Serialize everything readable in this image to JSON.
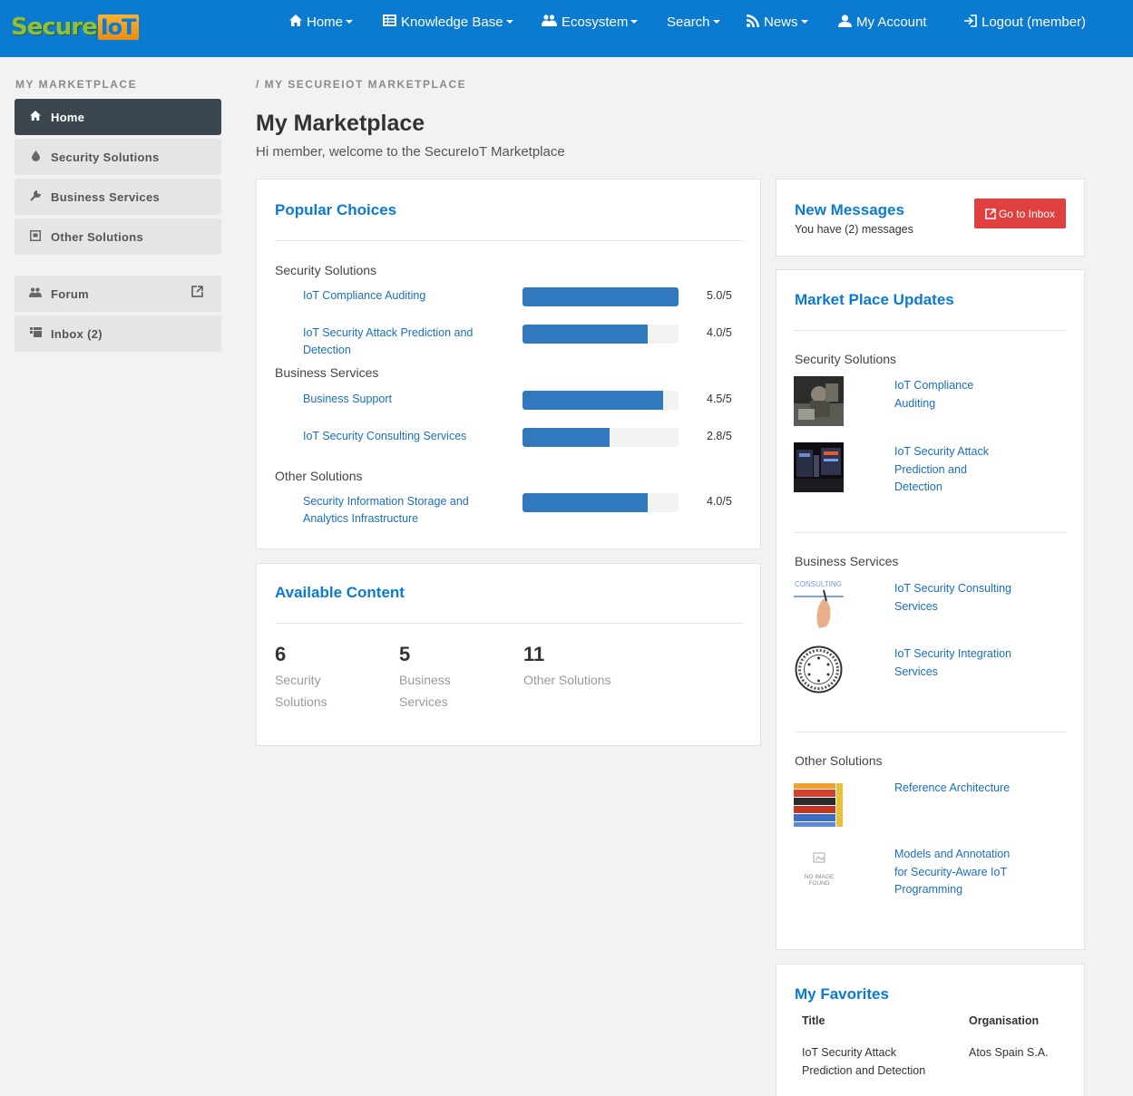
{
  "brand": {
    "part1": "Secure",
    "part2": "IoT"
  },
  "nav": {
    "home": "Home",
    "knowledge_base": "Knowledge Base",
    "ecosystem": "Ecosystem",
    "search": "Search",
    "news": "News",
    "my_account": "My Account",
    "logout": "Logout (member)"
  },
  "sidebar": {
    "title": "MY MARKETPLACE",
    "items": [
      {
        "label": "Home",
        "icon": "home-icon"
      },
      {
        "label": "Security Solutions",
        "icon": "drop-icon"
      },
      {
        "label": "Business Services",
        "icon": "tool-icon"
      },
      {
        "label": "Other Solutions",
        "icon": "box-icon"
      },
      {
        "label": "Forum",
        "icon": "users-icon"
      },
      {
        "label": "Inbox (2)",
        "icon": "inbox-icon"
      }
    ]
  },
  "breadcrumb": "/ MY SECUREIOT MARKETPLACE",
  "page_title": "My Marketplace",
  "welcome": "Hi member, welcome to the SecureIoT Marketplace",
  "popular": {
    "title": "Popular Choices",
    "groups": [
      "Security Solutions",
      "Business Services",
      "Other Solutions"
    ],
    "items": [
      {
        "label": "IoT Compliance Auditing",
        "rating": "5.0/5",
        "score": 5.0
      },
      {
        "label": "IoT Security Attack Prediction and Detection",
        "rating": "4.0/5",
        "score": 4.0
      },
      {
        "label": "Business Support",
        "rating": "4.5/5",
        "score": 4.5
      },
      {
        "label": "IoT Security Consulting Services",
        "rating": "2.8/5",
        "score": 2.8
      },
      {
        "label": "Security Information Storage and Analytics Infrastructure",
        "rating": "4.0/5",
        "score": 4.0
      }
    ]
  },
  "available": {
    "title": "Available Content",
    "stats": [
      {
        "num": "6",
        "label": "Security Solutions"
      },
      {
        "num": "5",
        "label": "Business Services"
      },
      {
        "num": "11",
        "label": "Other Solutions"
      }
    ]
  },
  "messages": {
    "title": "New Messages",
    "text": "You have (2) messages",
    "button": "Go to Inbox"
  },
  "updates": {
    "title": "Market Place Updates",
    "groups": [
      "Security Solutions",
      "Business Services",
      "Other Solutions"
    ],
    "items": [
      {
        "label": "IoT Compliance Auditing"
      },
      {
        "label": "IoT Security Attack Prediction and Detection"
      },
      {
        "label": "IoT Security Consulting Services",
        "thumb_text": "CONSULTING"
      },
      {
        "label": "IoT Security Integration Services"
      },
      {
        "label": "Reference Architecture"
      },
      {
        "label": "Models and Annotation for Security-Aware IoT Programming",
        "thumb_text": "NO IMAGE FOUND"
      }
    ]
  },
  "favorites": {
    "title": "My Favorites",
    "col_title": "Title",
    "col_org": "Organisation",
    "rows": [
      {
        "title": "IoT Security Attack Prediction and Detection",
        "org": "Atos Spain S.A."
      }
    ]
  },
  "colors": {
    "primary": "#0b7ad1",
    "bar": "#3079be",
    "danger": "#e0403f",
    "sidebar_active": "#3c464f"
  }
}
